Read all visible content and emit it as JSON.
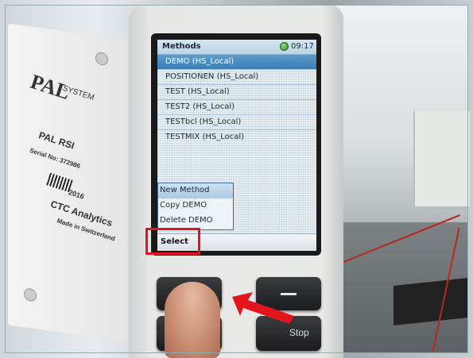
{
  "label_card": {
    "logo": "PAL",
    "logo_suffix": "SYSTEM",
    "model": "PAL RSI",
    "serial": "Serial No: 372986",
    "year": "2016",
    "maker": "CTC Analytics",
    "made_in": "Made in Switzerland"
  },
  "screen": {
    "title": "Methods",
    "clock": "09:17",
    "status_color": "#2b8f2b",
    "methods": [
      {
        "label": "DEMO (HS_Local)",
        "selected": true
      },
      {
        "label": "POSITIONEN (HS_Local)",
        "selected": false
      },
      {
        "label": "TEST (HS_Local)",
        "selected": false
      },
      {
        "label": "TEST2 (HS_Local)",
        "selected": false
      },
      {
        "label": "TESTbcl (HS_Local)",
        "selected": false
      },
      {
        "label": "TESTMIX (HS_Local)",
        "selected": false
      }
    ],
    "popup_menu": [
      {
        "label": "New Method",
        "highlighted": true
      },
      {
        "label": "Copy DEMO",
        "highlighted": false
      },
      {
        "label": "Delete DEMO",
        "highlighted": false
      }
    ],
    "softkey_left": "Select"
  },
  "hardware_keys": {
    "right_top_symbol": "minus-icon",
    "stop_label": "Stop"
  },
  "annotation": {
    "highlight_color": "#e3141b",
    "arrow_color": "#e3141b"
  }
}
